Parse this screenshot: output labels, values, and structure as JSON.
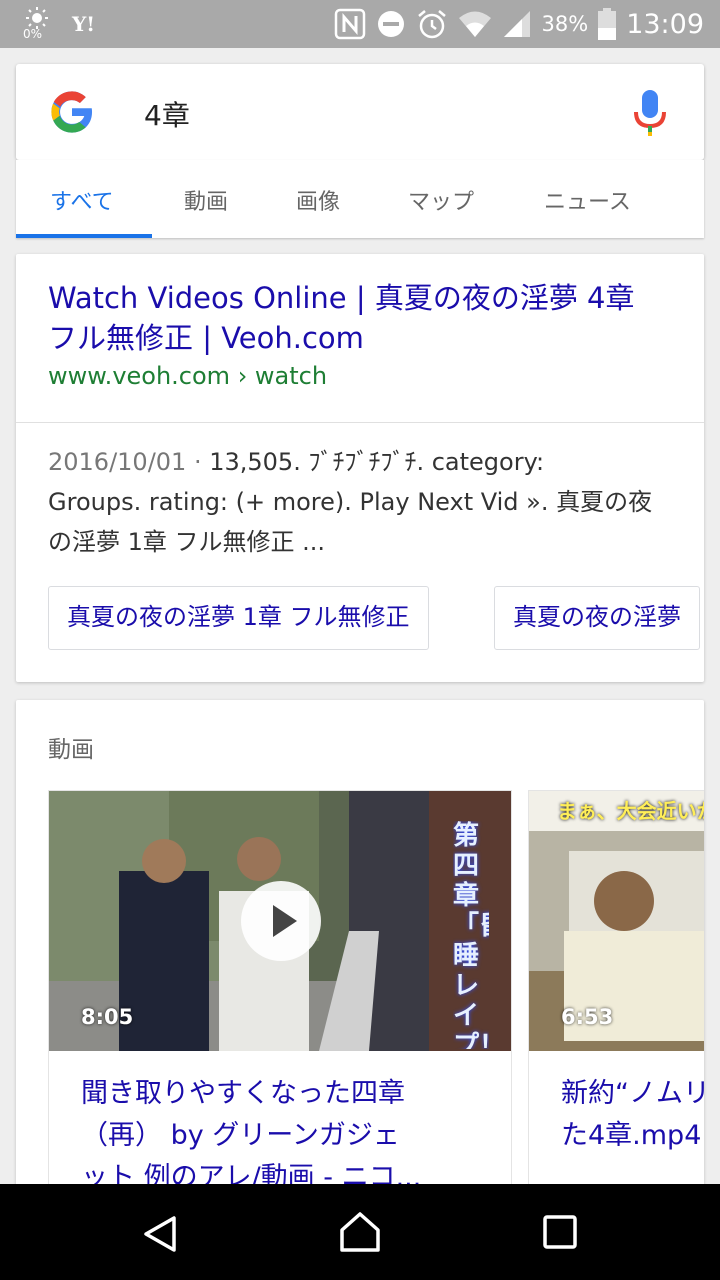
{
  "status_bar": {
    "brightness_pct": "0%",
    "yahoo_label": "Y!",
    "battery_pct": "38%",
    "time": "13:09",
    "icons": [
      "brightness-icon",
      "yahoo-icon",
      "nfc-icon",
      "dnd-icon",
      "alarm-icon",
      "wifi-icon",
      "signal-icon",
      "battery-icon"
    ]
  },
  "search": {
    "query": "4章",
    "logo_icon": "google-g-icon",
    "mic_icon": "mic-icon"
  },
  "tabs": [
    {
      "label": "すべて",
      "active": true
    },
    {
      "label": "動画",
      "active": false
    },
    {
      "label": "画像",
      "active": false
    },
    {
      "label": "マップ",
      "active": false
    },
    {
      "label": "ニュース",
      "active": false
    }
  ],
  "result": {
    "title_line1": "Watch Videos Online | 真夏の夜の淫夢 4章",
    "title_line2": "フル無修正 | Veoh.com",
    "url": "www.veoh.com › watch",
    "date": "2016/10/01",
    "snippet_dot": " · ",
    "snippet_line1": "13,505. ﾌﾞﾁﾌﾞﾁﾌﾞﾁ. category:",
    "snippet_line2": "Groups. rating: (+ more). Play Next Vid ». 真夏の夜",
    "snippet_line3": "の淫夢 1章 フル無修正 ...",
    "chips": [
      "真夏の夜の淫夢 1章 フル無修正",
      "真夏の夜の淫夢"
    ]
  },
  "videos": {
    "section_title": "動画",
    "items": [
      {
        "duration": "8:05",
        "title_line1": "聞き取りやすくなった四章",
        "title_line2": "（再） by グリーンガジェ",
        "title_line3": "ット 例のアレ/動画 - ニコ...",
        "overlay_text": "第四章 「昏睡レイプ！野獣と化した…",
        "has_play_icon": true
      },
      {
        "duration": "6:53",
        "title_line1": "新約“ノムリ",
        "title_line2": "た4章.mp4",
        "overlay_text": "まぁ、大会近いか",
        "has_play_icon": false
      }
    ]
  },
  "nav": {
    "icons": [
      "back-icon",
      "home-icon",
      "recents-icon"
    ]
  },
  "colors": {
    "status_bar": "#a9a9a9",
    "link": "#1a0dab",
    "url": "#1e7e34",
    "tab_active": "#1a73e8",
    "nav_bar": "#000000"
  }
}
